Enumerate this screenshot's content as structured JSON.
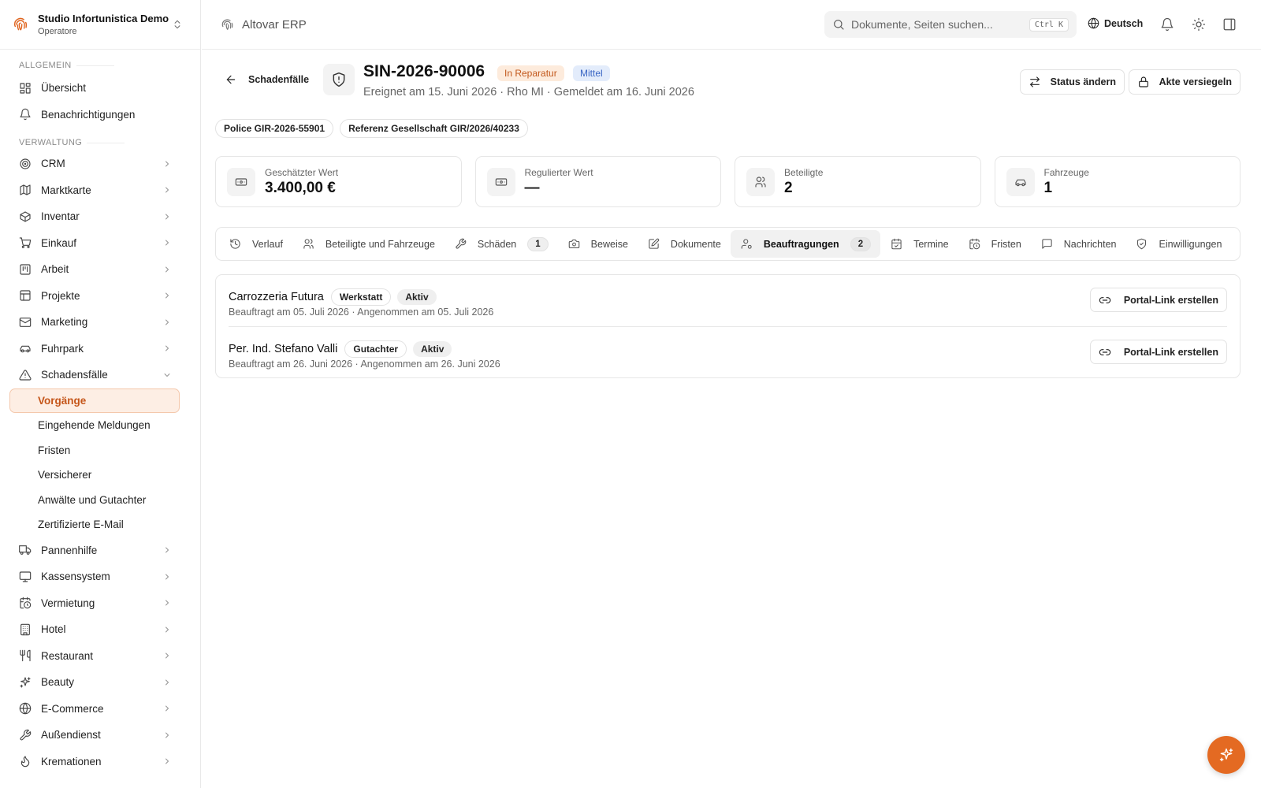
{
  "brand": {
    "title": "Studio Infortunistica Demo",
    "subtitle": "Operatore"
  },
  "sidebar": {
    "section_general": "Allgemein",
    "section_admin": "Verwaltung",
    "general_items": [
      {
        "label": "Übersicht",
        "icon": "dashboard-icon"
      },
      {
        "label": "Benachrichtigungen",
        "icon": "bell-icon"
      }
    ],
    "admin_items": [
      {
        "label": "CRM",
        "icon": "target-icon"
      },
      {
        "label": "Marktkarte",
        "icon": "map-icon"
      },
      {
        "label": "Inventar",
        "icon": "package-icon"
      },
      {
        "label": "Einkauf",
        "icon": "cart-icon"
      },
      {
        "label": "Arbeit",
        "icon": "kanban-icon"
      },
      {
        "label": "Projekte",
        "icon": "project-icon"
      },
      {
        "label": "Marketing",
        "icon": "mail-icon"
      },
      {
        "label": "Fuhrpark",
        "icon": "car-icon"
      },
      {
        "label": "Schadensfälle",
        "icon": "warning-icon"
      }
    ],
    "claims_subitems": [
      "Vorgänge",
      "Eingehende Meldungen",
      "Fristen",
      "Versicherer",
      "Anwälte und Gutachter",
      "Zertifizierte E-Mail"
    ],
    "more_items": [
      {
        "label": "Pannenhilfe",
        "icon": "truck-icon"
      },
      {
        "label": "Kassensystem",
        "icon": "monitor-icon"
      },
      {
        "label": "Vermietung",
        "icon": "calendar-clock-icon"
      },
      {
        "label": "Hotel",
        "icon": "building-icon"
      },
      {
        "label": "Restaurant",
        "icon": "utensils-icon"
      },
      {
        "label": "Beauty",
        "icon": "sparkles-icon"
      },
      {
        "label": "E-Commerce",
        "icon": "globe-icon"
      },
      {
        "label": "Außendienst",
        "icon": "wrench-icon"
      },
      {
        "label": "Kremationen",
        "icon": "flame-icon"
      }
    ]
  },
  "topbar": {
    "app_name": "Altovar ERP",
    "search_placeholder": "Dokumente, Seiten suchen...",
    "search_shortcut": "Ctrl K",
    "language": "Deutsch"
  },
  "case": {
    "back_label": "Schadenfälle",
    "id": "SIN-2026-90006",
    "status": "In Reparatur",
    "priority": "Mittel",
    "meta": "Ereignet am 15. Juni 2026 · Rho MI · Gemeldet am 16. Juni 2026",
    "change_status_label": "Status ändern",
    "seal_label": "Akte versiegeln",
    "chips": [
      "Police GIR-2026-55901",
      "Referenz Gesellschaft GIR/2026/40233"
    ]
  },
  "stats": [
    {
      "label": "Geschätzter Wert",
      "value": "3.400,00 €",
      "icon": "banknote-icon"
    },
    {
      "label": "Regulierter Wert",
      "value": "—",
      "icon": "banknote-icon"
    },
    {
      "label": "Beteiligte",
      "value": "2",
      "icon": "users-icon"
    },
    {
      "label": "Fahrzeuge",
      "value": "1",
      "icon": "car-icon"
    }
  ],
  "tabs": [
    {
      "label": "Verlauf",
      "icon": "history-icon"
    },
    {
      "label": "Beteiligte und Fahrzeuge",
      "icon": "users-icon"
    },
    {
      "label": "Schäden",
      "icon": "wrench-icon",
      "count": "1"
    },
    {
      "label": "Beweise",
      "icon": "camera-icon"
    },
    {
      "label": "Dokumente",
      "icon": "file-edit-icon"
    },
    {
      "label": "Beauftragungen",
      "icon": "user-gear-icon",
      "count": "2",
      "active": true
    },
    {
      "label": "Termine",
      "icon": "calendar-icon"
    },
    {
      "label": "Fristen",
      "icon": "calendar-clock-icon"
    },
    {
      "label": "Nachrichten",
      "icon": "message-icon"
    },
    {
      "label": "Einwilligungen",
      "icon": "shield-check-icon"
    }
  ],
  "assignments": [
    {
      "name": "Carrozzeria Futura",
      "role": "Werkstatt",
      "state": "Aktiv",
      "detail": "Beauftragt am 05. Juli 2026 · Angenommen am 05. Juli 2026",
      "action": "Portal-Link erstellen"
    },
    {
      "name": "Per. Ind. Stefano Valli",
      "role": "Gutachter",
      "state": "Aktiv",
      "detail": "Beauftragt am 26. Juni 2026 · Angenommen am 26. Juni 2026",
      "action": "Portal-Link erstellen"
    }
  ],
  "colors": {
    "accent": "#e46a22",
    "status_bg": "#fdebdc",
    "priority_bg": "#e3ecfb"
  }
}
